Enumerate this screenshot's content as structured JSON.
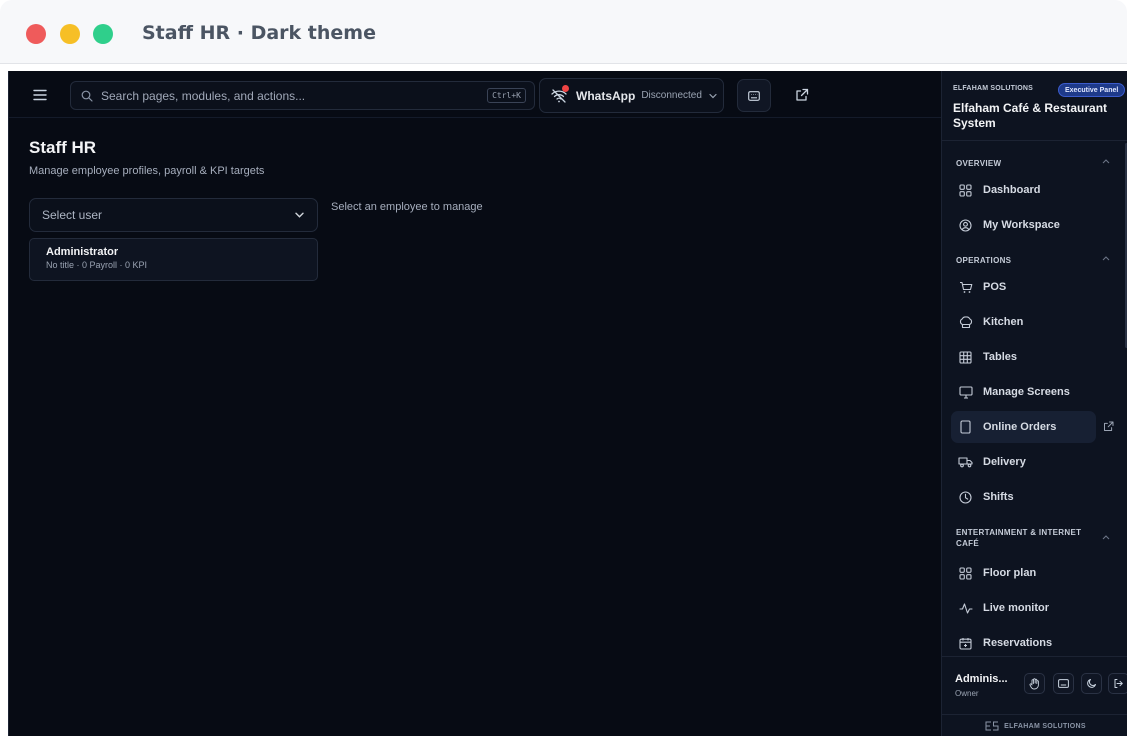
{
  "window": {
    "title": "Staff HR · Dark theme"
  },
  "topbar": {
    "search_placeholder": "Search pages, modules, and actions...",
    "search_shortcut": "Ctrl+K",
    "whatsapp": {
      "name": "WhatsApp",
      "status": "Disconnected"
    }
  },
  "page": {
    "title": "Staff HR",
    "subtitle": "Manage employee profiles, payroll & KPI targets",
    "select_placeholder": "Select user",
    "hint": "Select an employee to manage",
    "employees": [
      {
        "name": "Administrator",
        "meta": "No title · 0 Payroll · 0 KPI"
      }
    ]
  },
  "sidebar": {
    "company": "ELFAHAM SOLUTIONS",
    "badge": "Executive Panel",
    "system_name": "Elfaham Café & Restaurant System",
    "sections": [
      {
        "label": "OVERVIEW",
        "items": [
          {
            "label": "Dashboard",
            "icon": "dashboard-icon"
          },
          {
            "label": "My Workspace",
            "icon": "user-circle-icon"
          }
        ]
      },
      {
        "label": "OPERATIONS",
        "items": [
          {
            "label": "POS",
            "icon": "cart-icon"
          },
          {
            "label": "Kitchen",
            "icon": "chef-hat-icon"
          },
          {
            "label": "Tables",
            "icon": "grid-icon"
          },
          {
            "label": "Manage Screens",
            "icon": "monitor-icon"
          },
          {
            "label": "Online Orders",
            "icon": "tablet-icon"
          },
          {
            "label": "Delivery",
            "icon": "truck-icon"
          },
          {
            "label": "Shifts",
            "icon": "clock-icon"
          }
        ]
      },
      {
        "label": "ENTERTAINMENT & INTERNET CAFÉ",
        "items": [
          {
            "label": "Floor plan",
            "icon": "layout-icon"
          },
          {
            "label": "Live monitor",
            "icon": "activity-icon"
          },
          {
            "label": "Reservations",
            "icon": "calendar-icon"
          }
        ]
      }
    ],
    "user": {
      "name": "Adminis...",
      "role": "Owner"
    },
    "footer_brand": "ELFAHAM SOLUTIONS"
  },
  "colors": {
    "background": "#070b14",
    "sidebar": "#0d1320",
    "badge": "#1e3a8a",
    "whatsapp_status_dot": "#ef4444"
  }
}
